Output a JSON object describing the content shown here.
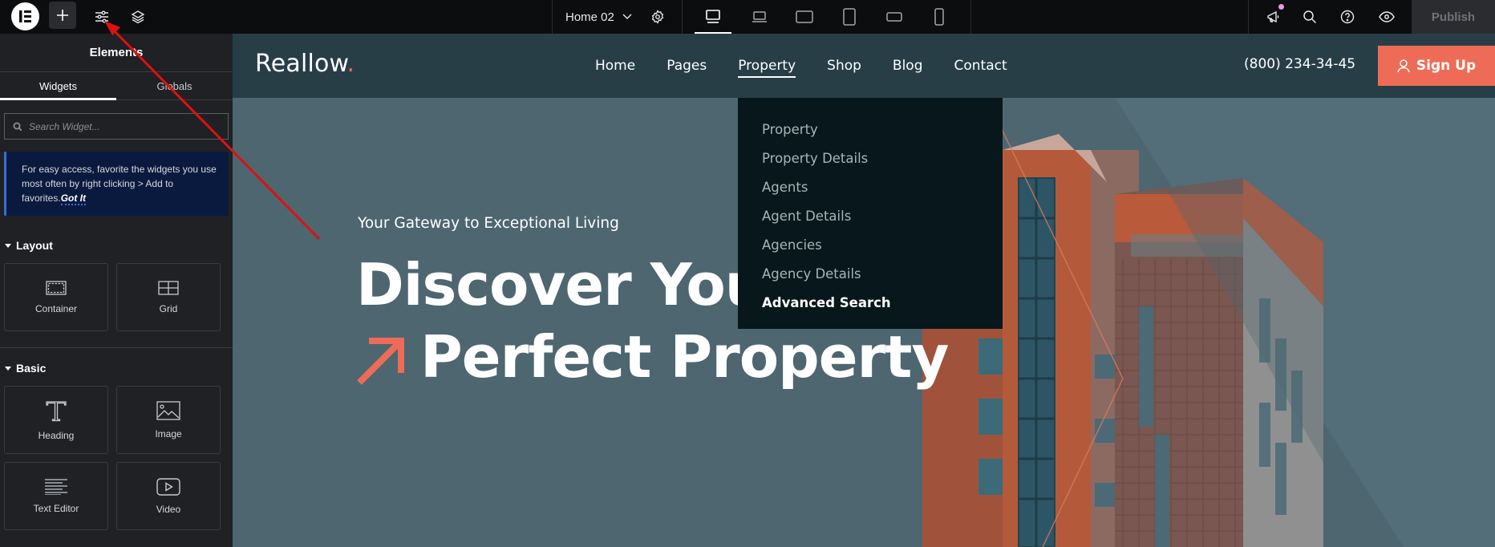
{
  "topbar": {
    "page_name": "Home 02",
    "publish_label": "Publish",
    "icons": {
      "logo": "elementor-logo-icon",
      "add": "plus-icon",
      "site_settings": "sliders-icon",
      "structure": "layers-icon",
      "page_settings": "gear-icon",
      "notifications": "megaphone-icon",
      "search": "search-icon",
      "help": "help-icon",
      "preview": "eye-icon"
    },
    "devices": [
      "desktop",
      "laptop",
      "tablet-landscape",
      "tablet",
      "mobile-landscape",
      "mobile"
    ],
    "active_device": "desktop",
    "notification_dot_color": "#e79ae5"
  },
  "sidebar": {
    "title": "Elements",
    "tabs": [
      {
        "label": "Widgets",
        "active": true
      },
      {
        "label": "Globals",
        "active": false
      }
    ],
    "search_placeholder": "Search Widget...",
    "tip": {
      "text": "For easy access, favorite the widgets you use most often by right clicking > Add to favorites.",
      "action": "Got It"
    },
    "sections": [
      {
        "title": "Layout",
        "widgets": [
          {
            "label": "Container",
            "icon": "container-icon"
          },
          {
            "label": "Grid",
            "icon": "grid-icon"
          }
        ]
      },
      {
        "title": "Basic",
        "widgets": [
          {
            "label": "Heading",
            "icon": "heading-icon"
          },
          {
            "label": "Image",
            "icon": "image-icon"
          },
          {
            "label": "Text Editor",
            "icon": "text-editor-icon"
          },
          {
            "label": "Video",
            "icon": "video-icon"
          }
        ]
      }
    ],
    "collapse_glyph": "‹"
  },
  "site": {
    "logo_text": "Reallow",
    "logo_dot": ".",
    "nav": [
      {
        "label": "Home",
        "active": false
      },
      {
        "label": "Pages",
        "active": false
      },
      {
        "label": "Property",
        "active": true
      },
      {
        "label": "Shop",
        "active": false
      },
      {
        "label": "Blog",
        "active": false
      },
      {
        "label": "Contact",
        "active": false
      }
    ],
    "phone": "(800) 234-34-45",
    "signup_label": "Sign Up",
    "dropdown": [
      {
        "label": "Property",
        "active": false
      },
      {
        "label": "Property Details",
        "active": false
      },
      {
        "label": "Agents",
        "active": false
      },
      {
        "label": "Agent Details",
        "active": false
      },
      {
        "label": "Agencies",
        "active": false
      },
      {
        "label": "Agency Details",
        "active": false
      },
      {
        "label": "Advanced Search",
        "active": true
      }
    ],
    "hero": {
      "tagline": "Your Gateway to Exceptional Living",
      "title_line1": "Discover Your",
      "title_line2": "Perfect Property"
    },
    "colors": {
      "accent": "#ee6c57",
      "header_bg": "#273e47",
      "hero_bg": "#4d6670",
      "dropdown_bg": "#07171b"
    }
  },
  "annotation": {
    "type": "arrow",
    "color": "#e01010",
    "target": "site-settings-button"
  }
}
